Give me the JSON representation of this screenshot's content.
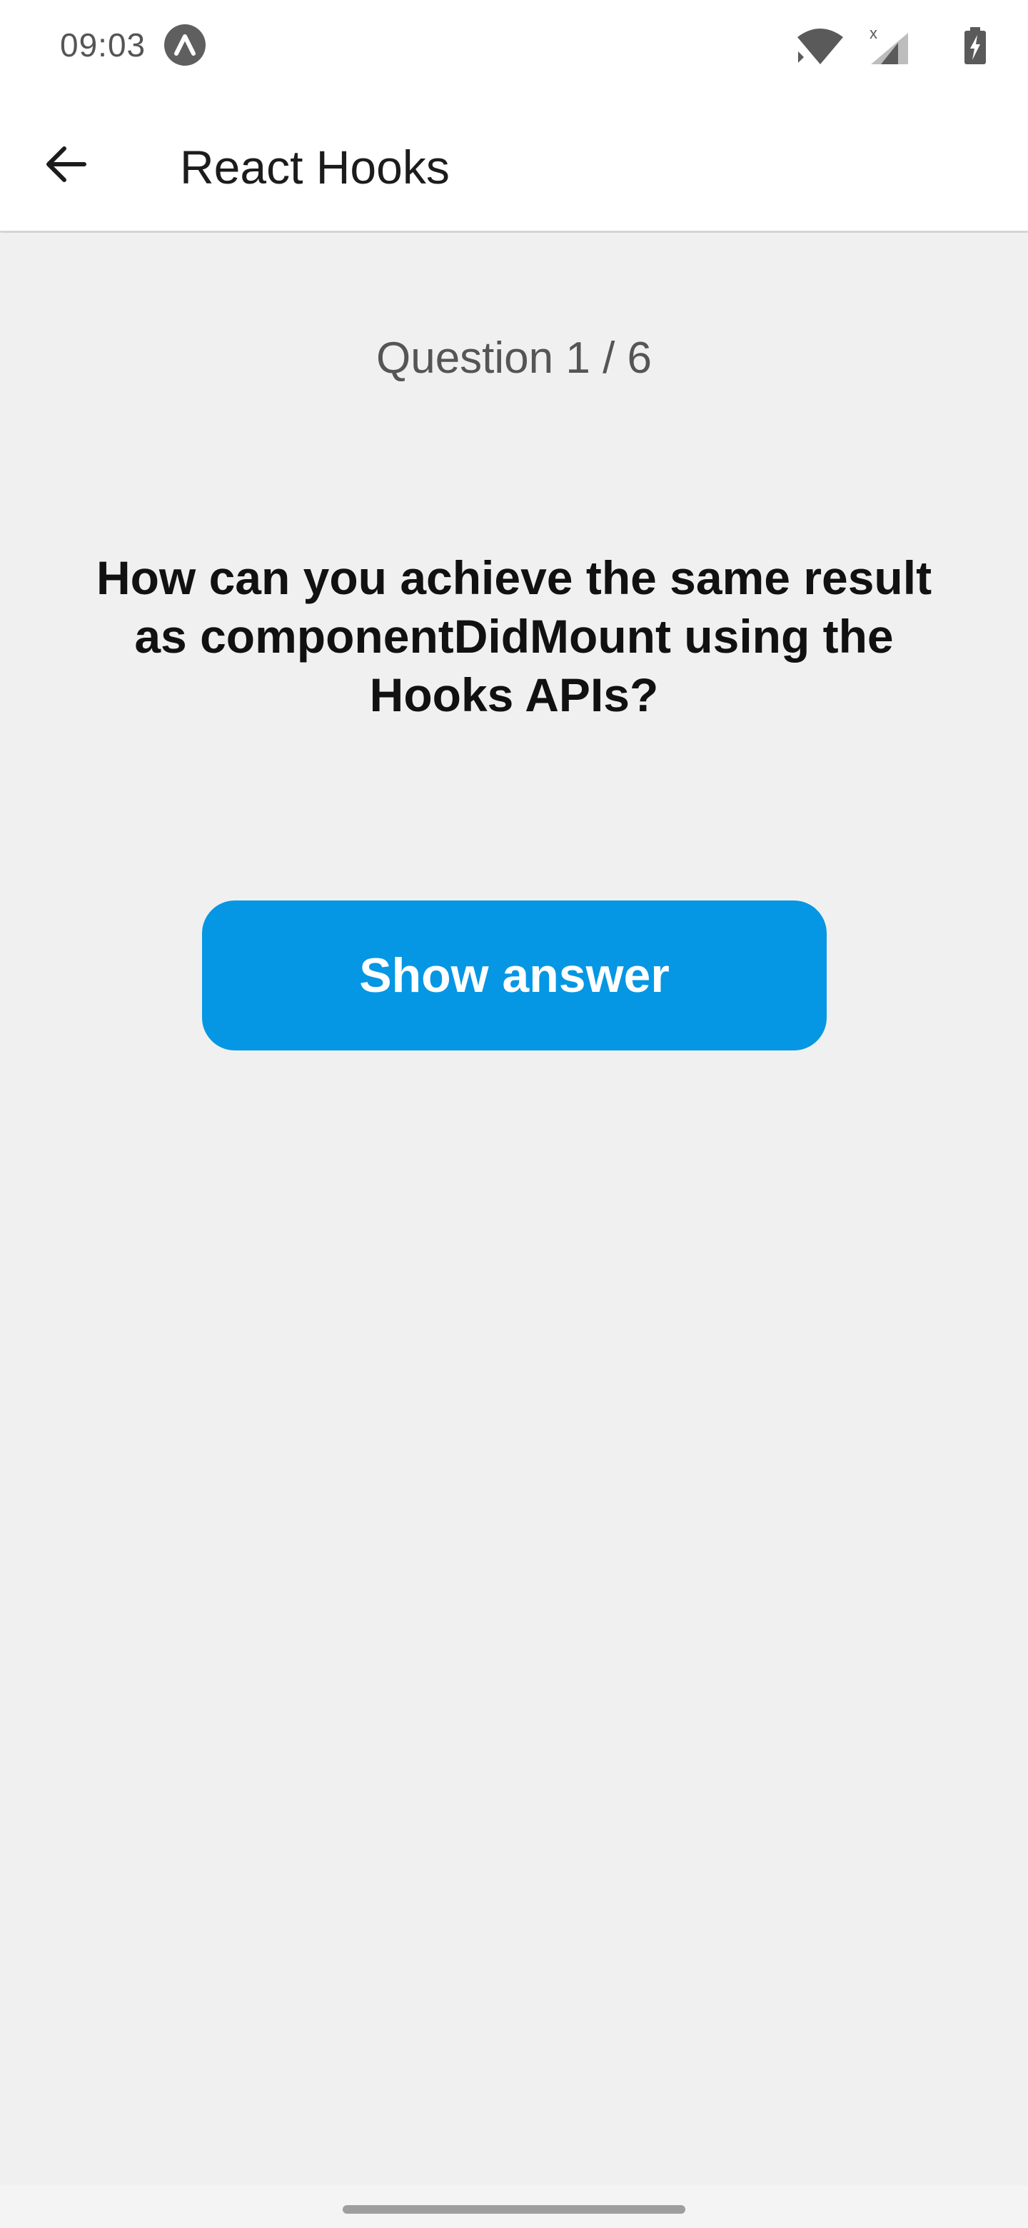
{
  "status_bar": {
    "time": "09:03",
    "icons": [
      "app-notification-icon",
      "wifi-icon",
      "cell-signal-icon",
      "battery-charging-icon"
    ],
    "signal_badge": "x"
  },
  "app_bar": {
    "back_icon": "arrow-left-icon",
    "title": "React Hooks"
  },
  "quiz": {
    "counter": "Question 1 / 6",
    "question": "How can you achieve the same result as componentDidMount using the Hooks APIs?",
    "show_answer_label": "Show answer"
  },
  "colors": {
    "accent": "#0597e3",
    "background": "#f0f0f0",
    "app_bar": "#ffffff"
  }
}
